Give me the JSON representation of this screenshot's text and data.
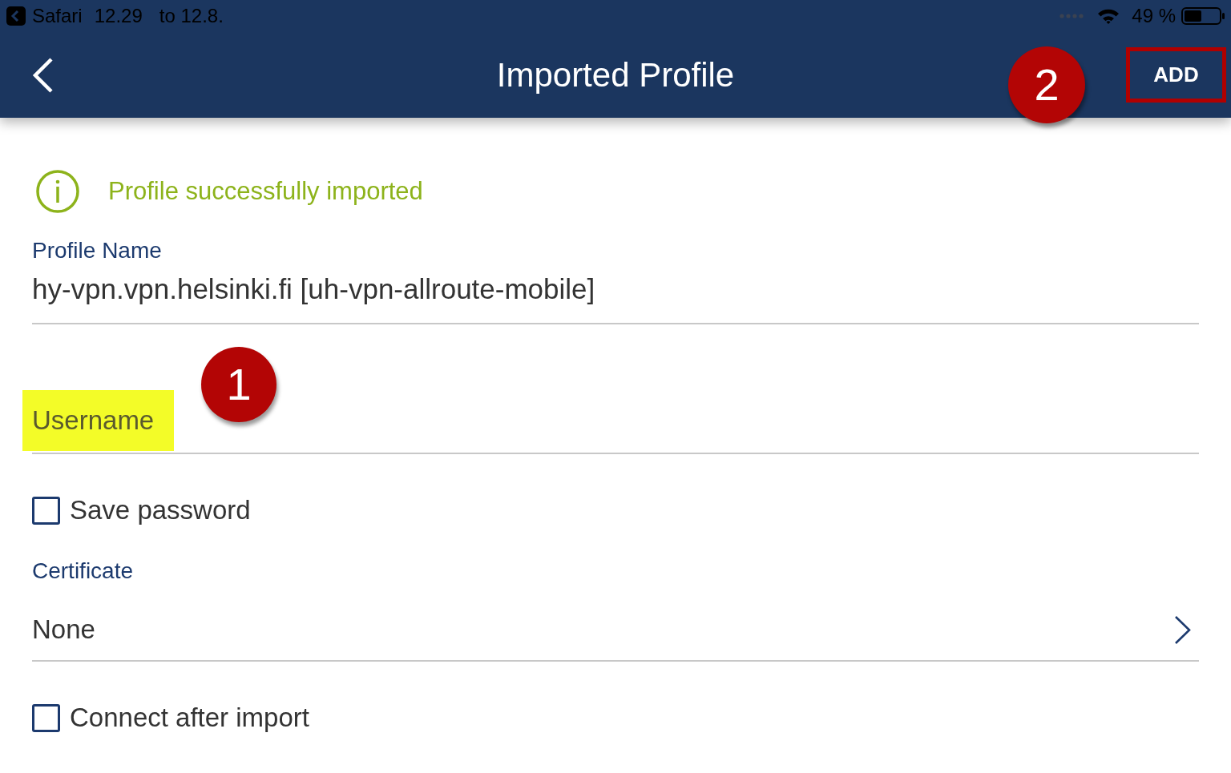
{
  "status_bar": {
    "back_to_app": "Safari",
    "time": "12.29",
    "date": "to 12.8.",
    "battery": "49 %"
  },
  "header": {
    "title": "Imported Profile",
    "action": {
      "label": "ADD",
      "outlined": true,
      "badge": "2"
    }
  },
  "notice": {
    "text": "Profile successfully imported"
  },
  "form": [
    {
      "kind": "text",
      "label": "Profile Name",
      "value": "hy-vpn.vpn.helsinki.fi [uh-vpn-allroute-mobile]"
    },
    {
      "kind": "input",
      "placeholder": "Username",
      "highlighted": true,
      "badge": "1"
    },
    {
      "kind": "checkbox",
      "label": "Save password",
      "checked": false
    },
    {
      "kind": "select",
      "label": "Certificate",
      "value": "None"
    },
    {
      "kind": "checkbox",
      "label": "Connect after import",
      "checked": false
    }
  ]
}
